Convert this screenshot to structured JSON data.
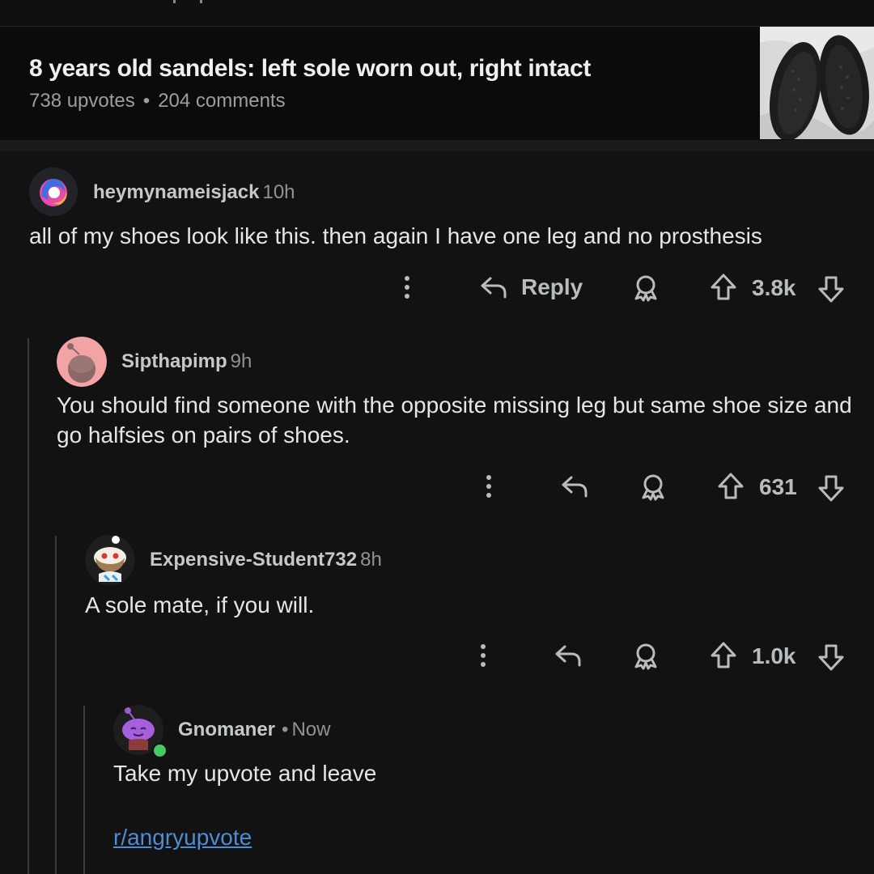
{
  "post": {
    "title": "8 years old sandels: left sole worn out, right intact",
    "upvotes": "738 upvotes",
    "separator": "•",
    "comments": "204 comments"
  },
  "comments": [
    {
      "username": "heymynameisjack",
      "time": "10h",
      "body": "all of my shoes look like this. then again I have one leg and no prosthesis",
      "reply_label": "Reply",
      "score": "3.8k"
    },
    {
      "username": "Sipthapimp",
      "time": "9h",
      "body": "You should find someone with the opposite missing leg but same shoe size and go halfsies on pairs of shoes.",
      "score": "631"
    },
    {
      "username": "Expensive-Student732",
      "time": "8h",
      "body": "A sole mate, if you will.",
      "score": "1.0k"
    },
    {
      "username": "Gnomaner",
      "separator": "•",
      "time": "Now",
      "body": "Take my upvote and leave",
      "link": "r/angryupvote"
    }
  ],
  "icons": {
    "more": "more-vertical-icon",
    "reply": "reply-arrow-icon",
    "award": "award-icon",
    "upvote": "upvote-arrow-icon",
    "downvote": "downvote-arrow-icon"
  },
  "colors": {
    "background": "#121212",
    "link": "#4f8bd6",
    "online": "#46c768"
  }
}
